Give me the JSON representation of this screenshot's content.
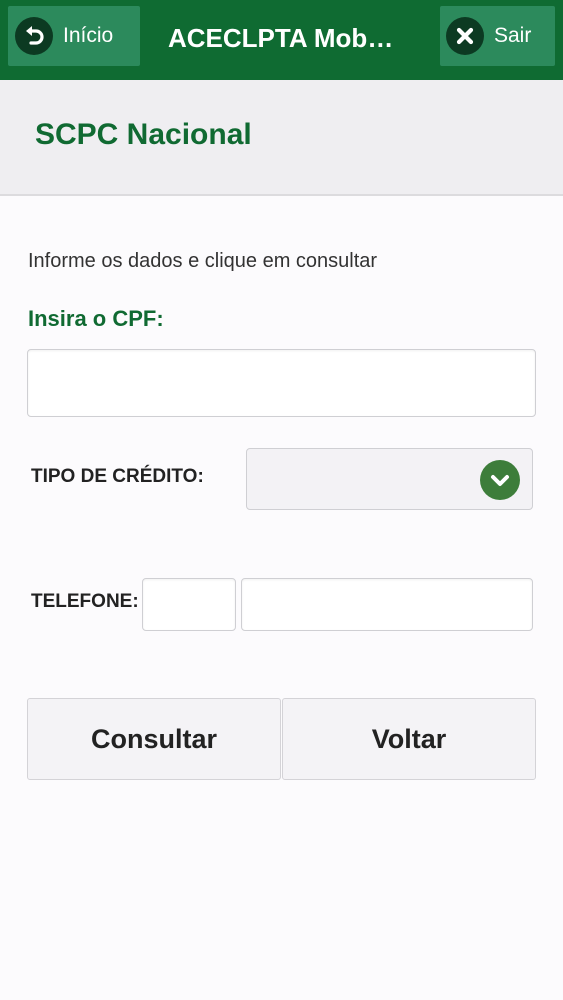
{
  "header": {
    "home_label": "Início",
    "title": "ACECLPTA Mobile",
    "exit_label": "Sair",
    "bg_color": "#0f6b32",
    "home_icon": "undo-arrow-icon",
    "exit_icon": "close-icon"
  },
  "page": {
    "title": "SCPC Nacional",
    "instructions": "Informe os dados e clique em consultar"
  },
  "form": {
    "cpf_label": "Insira o CPF:",
    "cpf_value": "",
    "cpf_placeholder": "",
    "credit_type_label": "TIPO DE CRÉDITO:",
    "credit_type_selected": "",
    "credit_type_icon": "chevron-down-icon",
    "phone_label": "TELEFONE:",
    "phone_area_value": "",
    "phone_number_value": ""
  },
  "actions": {
    "consult_label": "Consultar",
    "back_label": "Voltar"
  }
}
